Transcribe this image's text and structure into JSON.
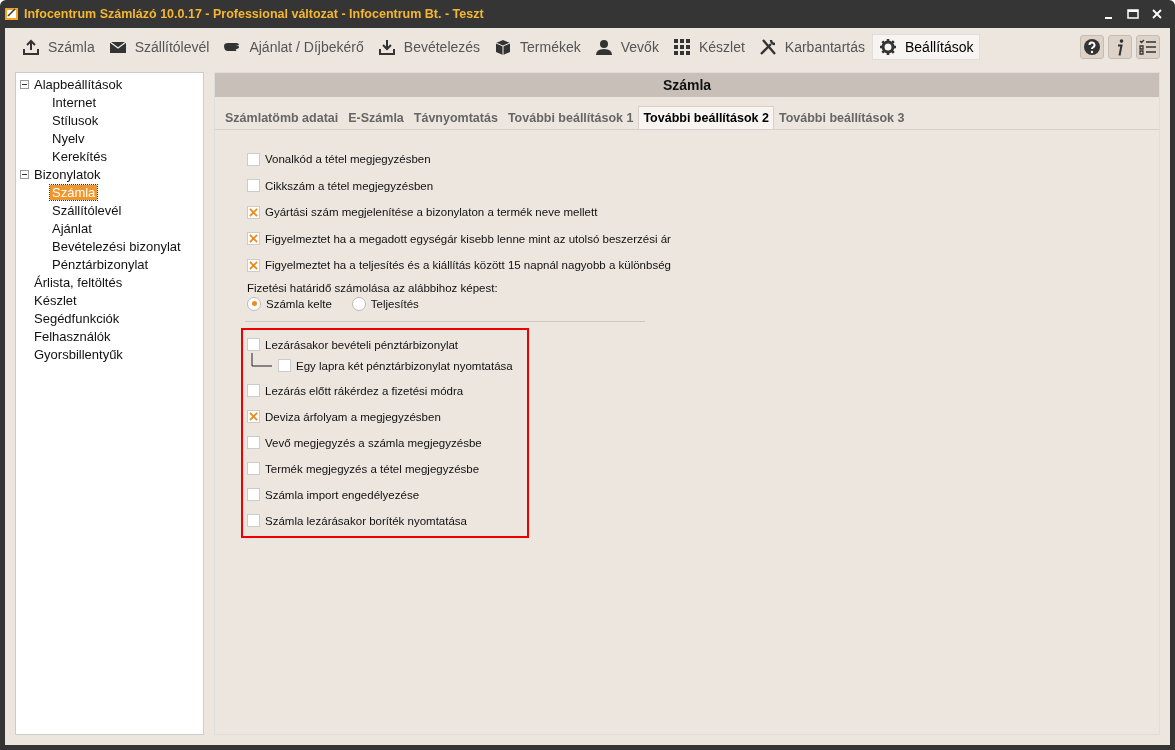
{
  "window": {
    "title": "Infocentrum Számlázó 10.0.17 - Professional változat - Infocentrum Bt. - Teszt"
  },
  "toolbar": [
    {
      "label": "Számla",
      "selected": false
    },
    {
      "label": "Szállítólevél",
      "selected": false
    },
    {
      "label": "Ajánlat / Díjbekérő",
      "selected": false
    },
    {
      "label": "Bevételezés",
      "selected": false
    },
    {
      "label": "Termékek",
      "selected": false
    },
    {
      "label": "Vevők",
      "selected": false
    },
    {
      "label": "Készlet",
      "selected": false
    },
    {
      "label": "Karbantartás",
      "selected": false
    },
    {
      "label": "Beállítások",
      "selected": true
    }
  ],
  "tree": [
    {
      "label": "Alapbeállítások",
      "expanded": true,
      "selected": false,
      "children": [
        {
          "label": "Internet",
          "selected": false
        },
        {
          "label": "Stílusok",
          "selected": false
        },
        {
          "label": "Nyelv",
          "selected": false
        },
        {
          "label": "Kerekítés",
          "selected": false
        }
      ]
    },
    {
      "label": "Bizonylatok",
      "expanded": true,
      "selected": false,
      "children": [
        {
          "label": "Számla",
          "selected": true
        },
        {
          "label": "Szállítólevél",
          "selected": false
        },
        {
          "label": "Ajánlat",
          "selected": false
        },
        {
          "label": "Bevételezési bizonylat",
          "selected": false
        },
        {
          "label": "Pénztárbizonylat",
          "selected": false
        }
      ]
    },
    {
      "label": "Árlista, feltöltés",
      "selected": false
    },
    {
      "label": "Készlet",
      "selected": false
    },
    {
      "label": "Segédfunkciók",
      "selected": false
    },
    {
      "label": "Felhasználók",
      "selected": false
    },
    {
      "label": "Gyorsbillentyűk",
      "selected": false
    }
  ],
  "panel": {
    "title": "Számla",
    "tabs": [
      {
        "label": "Számlatömb adatai",
        "selected": false
      },
      {
        "label": "E-Számla",
        "selected": false
      },
      {
        "label": "Távnyomtatás",
        "selected": false
      },
      {
        "label": "További beállítások 1",
        "selected": false
      },
      {
        "label": "További beállítások 2",
        "selected": true
      },
      {
        "label": "További beállítások 3",
        "selected": false
      }
    ],
    "options": [
      {
        "label": "Vonalkód a tétel megjegyzésben",
        "checked": false
      },
      {
        "label": "Cikkszám a tétel megjegyzésben",
        "checked": false
      },
      {
        "label": "Gyártási szám megjelenítése a bizonylaton a termék neve mellett",
        "checked": true
      },
      {
        "label": "Figyelmeztet ha a megadott egységár kisebb lenne mint az utolsó beszerzési ár",
        "checked": true
      },
      {
        "label": "Figyelmeztet ha a teljesítés és a kiállítás között 15 napnál nagyobb a különbség",
        "checked": true
      }
    ],
    "due_date": {
      "label": "Fizetési határidő számolása az alábbihoz képest:",
      "choices": [
        {
          "label": "Számla kelte",
          "selected": true
        },
        {
          "label": "Teljesítés",
          "selected": false
        }
      ]
    },
    "highlighted_options": [
      {
        "label": "Lezárásakor bevételi pénztárbizonylat",
        "checked": false,
        "children": [
          {
            "label": "Egy lapra két pénztárbizonylat nyomtatása",
            "checked": false
          }
        ]
      },
      {
        "label": "Lezárás előtt rákérdez a fizetési módra",
        "checked": false
      },
      {
        "label": "Deviza árfolyam a megjegyzésben",
        "checked": true
      },
      {
        "label": "Vevő megjegyzés a számla megjegyzésbe",
        "checked": false
      },
      {
        "label": "Termék megjegyzés a tétel megjegyzésbe",
        "checked": false
      },
      {
        "label": "Számla import engedélyezése",
        "checked": false
      },
      {
        "label": "Számla lezárásakor boríték nyomtatása",
        "checked": false
      }
    ]
  }
}
